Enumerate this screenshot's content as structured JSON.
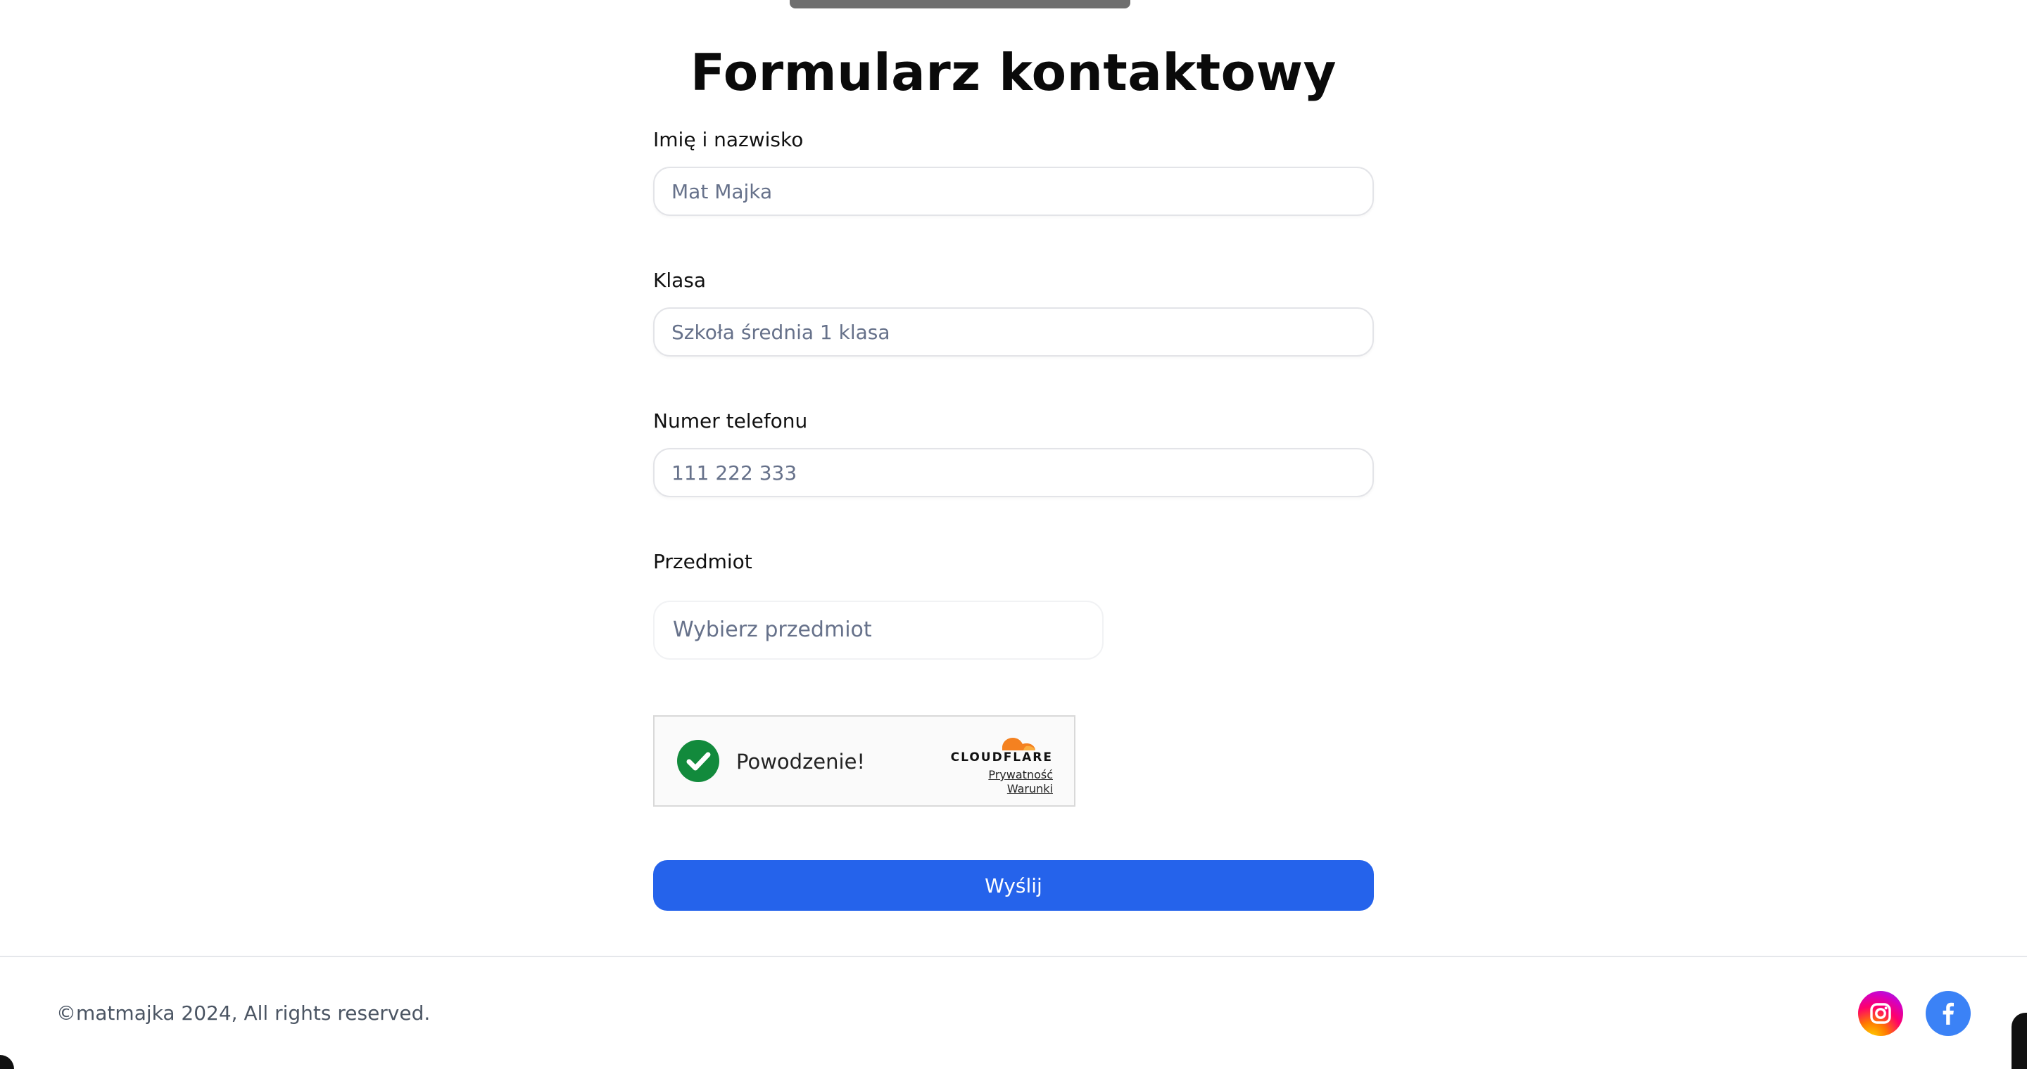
{
  "page": {
    "title": "Formularz kontaktowy"
  },
  "form": {
    "name_label": "Imię i nazwisko",
    "name_placeholder": "Mat Majka",
    "class_label": "Klasa",
    "class_placeholder": "Szkoła średnia 1 klasa",
    "phone_label": "Numer telefonu",
    "phone_placeholder": "111 222 333",
    "subject_label": "Przedmiot",
    "subject_selected": "Wybierz przedmiot",
    "submit_label": "Wyślij"
  },
  "captcha": {
    "status_text": "Powodzenie!",
    "brand": "CLOUDFLARE",
    "privacy_link": "Prywatność",
    "terms_link": "Warunki",
    "success_color": "#128a3c",
    "brand_color": "#f48120"
  },
  "footer": {
    "copyright": "©matmajka 2024, All rights reserved.",
    "social": [
      {
        "name": "instagram-icon"
      },
      {
        "name": "facebook-icon"
      }
    ]
  },
  "colors": {
    "accent": "#2563eb",
    "facebook": "#3b82f6"
  }
}
